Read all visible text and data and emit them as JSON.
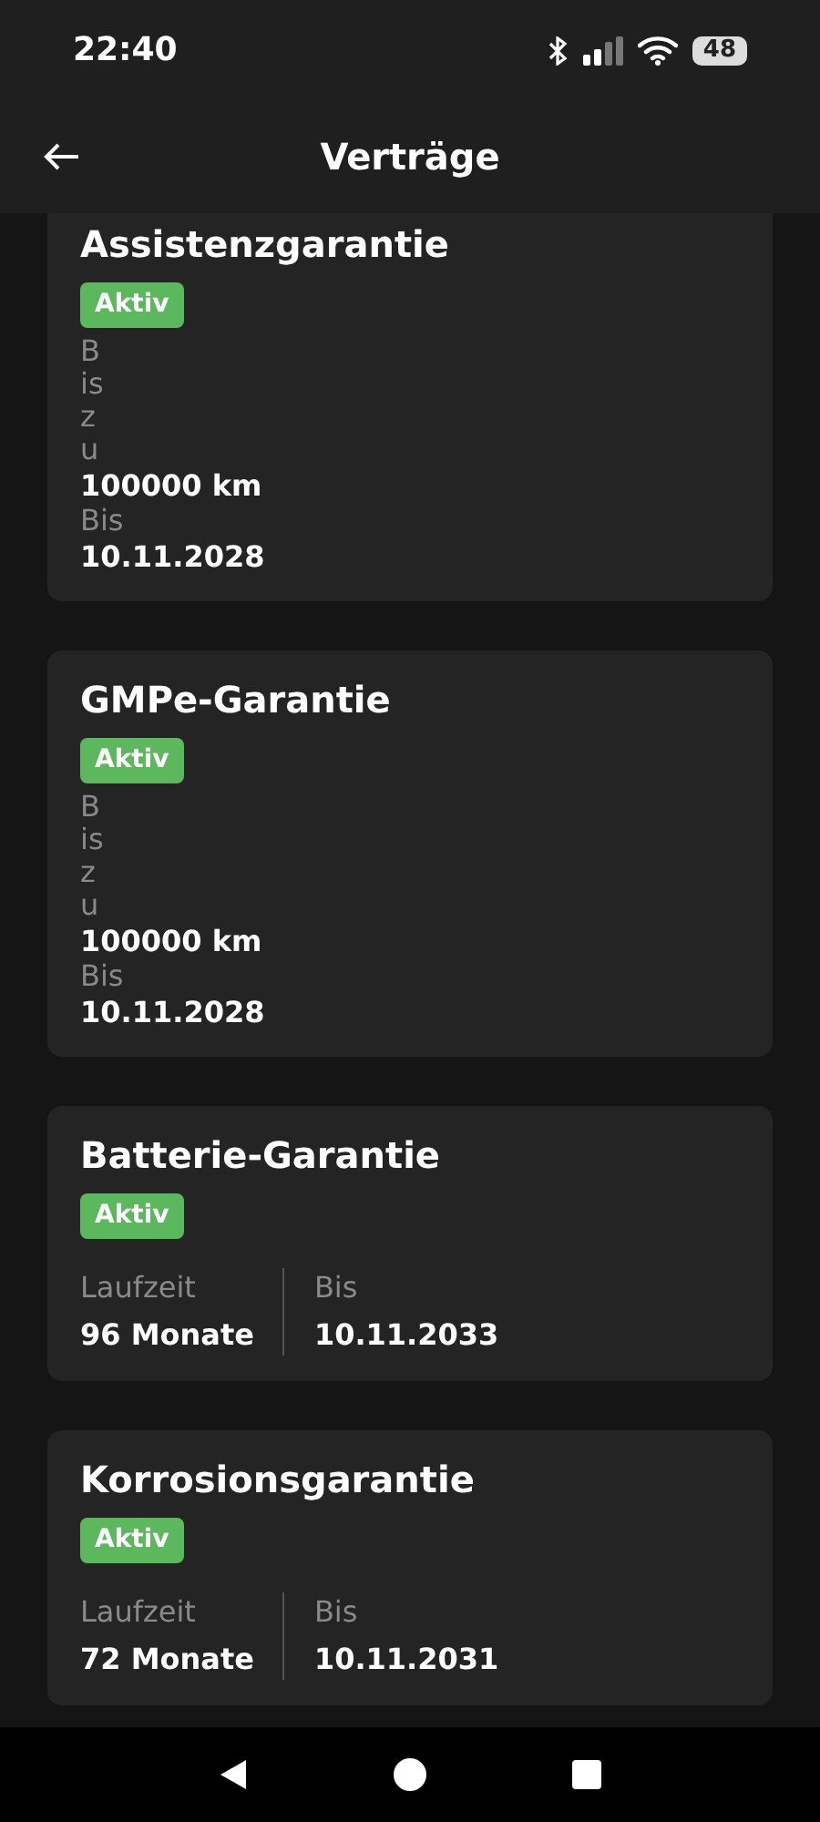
{
  "status_bar": {
    "time": "22:40",
    "battery": "48"
  },
  "header": {
    "title": "Verträge"
  },
  "contracts": [
    {
      "title": "Assistenzgarantie",
      "status": "Aktiv",
      "kind": "stacked",
      "details": [
        {
          "label": "Bis zu",
          "value": "100000 km"
        },
        {
          "label": "Bis",
          "value": "10.11.2028"
        }
      ]
    },
    {
      "title": "GMPe-Garantie",
      "status": "Aktiv",
      "kind": "stacked",
      "details": [
        {
          "label": "Bis zu",
          "value": "100000 km"
        },
        {
          "label": "Bis",
          "value": "10.11.2028"
        }
      ]
    },
    {
      "title": "Batterie-Garantie",
      "status": "Aktiv",
      "kind": "columns",
      "details": [
        {
          "label": "Laufzeit",
          "value": "96 Monate"
        },
        {
          "label": "Bis",
          "value": "10.11.2033"
        }
      ]
    },
    {
      "title": "Korrosionsgarantie",
      "status": "Aktiv",
      "kind": "columns",
      "details": [
        {
          "label": "Laufzeit",
          "value": "72 Monate"
        },
        {
          "label": "Bis",
          "value": "10.11.2031"
        }
      ]
    }
  ]
}
